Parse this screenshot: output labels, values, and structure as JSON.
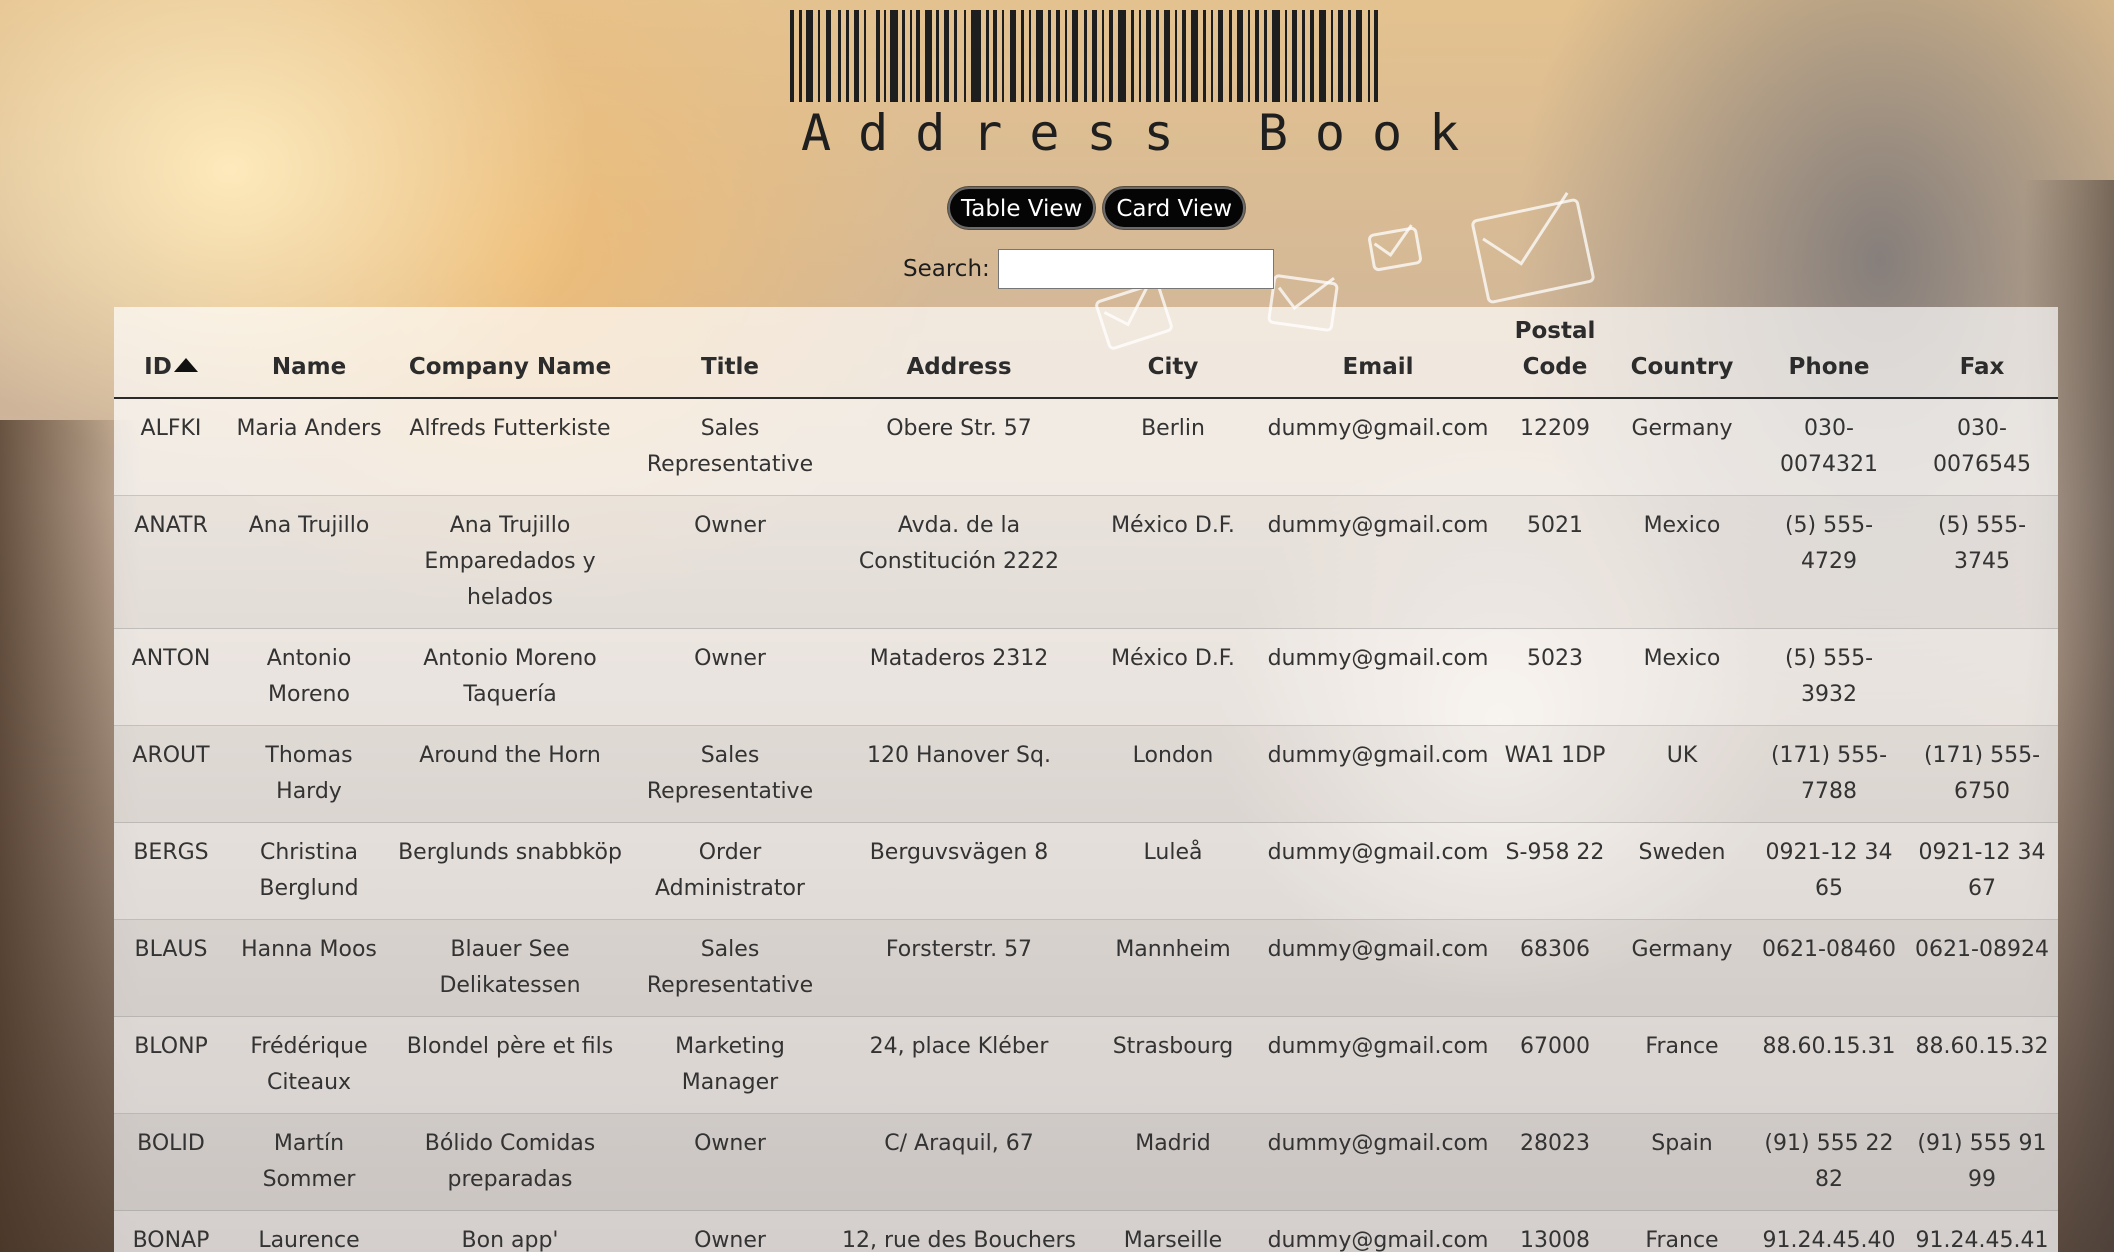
{
  "app": {
    "title": "Address Book"
  },
  "controls": {
    "table_view_label": "Table View",
    "card_view_label": "Card View",
    "search_label": "Search:",
    "search_value": ""
  },
  "table": {
    "sort_column": "ID",
    "sort_direction": "ascending",
    "columns": [
      "ID",
      "Name",
      "Company Name",
      "Title",
      "Address",
      "City",
      "Email",
      "Postal Code",
      "Country",
      "Phone",
      "Fax"
    ],
    "rows": [
      {
        "id": "ALFKI",
        "name": "Maria Anders",
        "company": "Alfreds Futterkiste",
        "title": "Sales Representative",
        "address": "Obere Str. 57",
        "city": "Berlin",
        "email": "dummy@gmail.com",
        "postal": "12209",
        "country": "Germany",
        "phone": "030-0074321",
        "fax": "030-0076545"
      },
      {
        "id": "ANATR",
        "name": "Ana Trujillo",
        "company": "Ana Trujillo Emparedados y helados",
        "title": "Owner",
        "address": "Avda. de la Constitución 2222",
        "city": "México D.F.",
        "email": "dummy@gmail.com",
        "postal": "5021",
        "country": "Mexico",
        "phone": "(5) 555-4729",
        "fax": "(5) 555-3745"
      },
      {
        "id": "ANTON",
        "name": "Antonio Moreno",
        "company": "Antonio Moreno Taquería",
        "title": "Owner",
        "address": "Mataderos 2312",
        "city": "México D.F.",
        "email": "dummy@gmail.com",
        "postal": "5023",
        "country": "Mexico",
        "phone": "(5) 555-3932",
        "fax": ""
      },
      {
        "id": "AROUT",
        "name": "Thomas Hardy",
        "company": "Around the Horn",
        "title": "Sales Representative",
        "address": "120 Hanover Sq.",
        "city": "London",
        "email": "dummy@gmail.com",
        "postal": "WA1 1DP",
        "country": "UK",
        "phone": "(171) 555-7788",
        "fax": "(171) 555-6750"
      },
      {
        "id": "BERGS",
        "name": "Christina Berglund",
        "company": "Berglunds snabbköp",
        "title": "Order Administrator",
        "address": "Berguvsvägen 8",
        "city": "Luleå",
        "email": "dummy@gmail.com",
        "postal": "S-958 22",
        "country": "Sweden",
        "phone": "0921-12 34 65",
        "fax": "0921-12 34 67"
      },
      {
        "id": "BLAUS",
        "name": "Hanna Moos",
        "company": "Blauer See Delikatessen",
        "title": "Sales Representative",
        "address": "Forsterstr. 57",
        "city": "Mannheim",
        "email": "dummy@gmail.com",
        "postal": "68306",
        "country": "Germany",
        "phone": "0621-08460",
        "fax": "0621-08924"
      },
      {
        "id": "BLONP",
        "name": "Frédérique Citeaux",
        "company": "Blondel père et fils",
        "title": "Marketing Manager",
        "address": "24, place Kléber",
        "city": "Strasbourg",
        "email": "dummy@gmail.com",
        "postal": "67000",
        "country": "France",
        "phone": "88.60.15.31",
        "fax": "88.60.15.32"
      },
      {
        "id": "BOLID",
        "name": "Martín Sommer",
        "company": "Bólido Comidas preparadas",
        "title": "Owner",
        "address": "C/ Araquil, 67",
        "city": "Madrid",
        "email": "dummy@gmail.com",
        "postal": "28023",
        "country": "Spain",
        "phone": "(91) 555 22 82",
        "fax": "(91) 555 91 99"
      },
      {
        "id": "BONAP",
        "name": "Laurence Lebihan",
        "company": "Bon app'",
        "title": "Owner",
        "address": "12, rue des Bouchers",
        "city": "Marseille",
        "email": "dummy@gmail.com",
        "postal": "13008",
        "country": "France",
        "phone": "91.24.45.40",
        "fax": "91.24.45.41"
      }
    ]
  }
}
